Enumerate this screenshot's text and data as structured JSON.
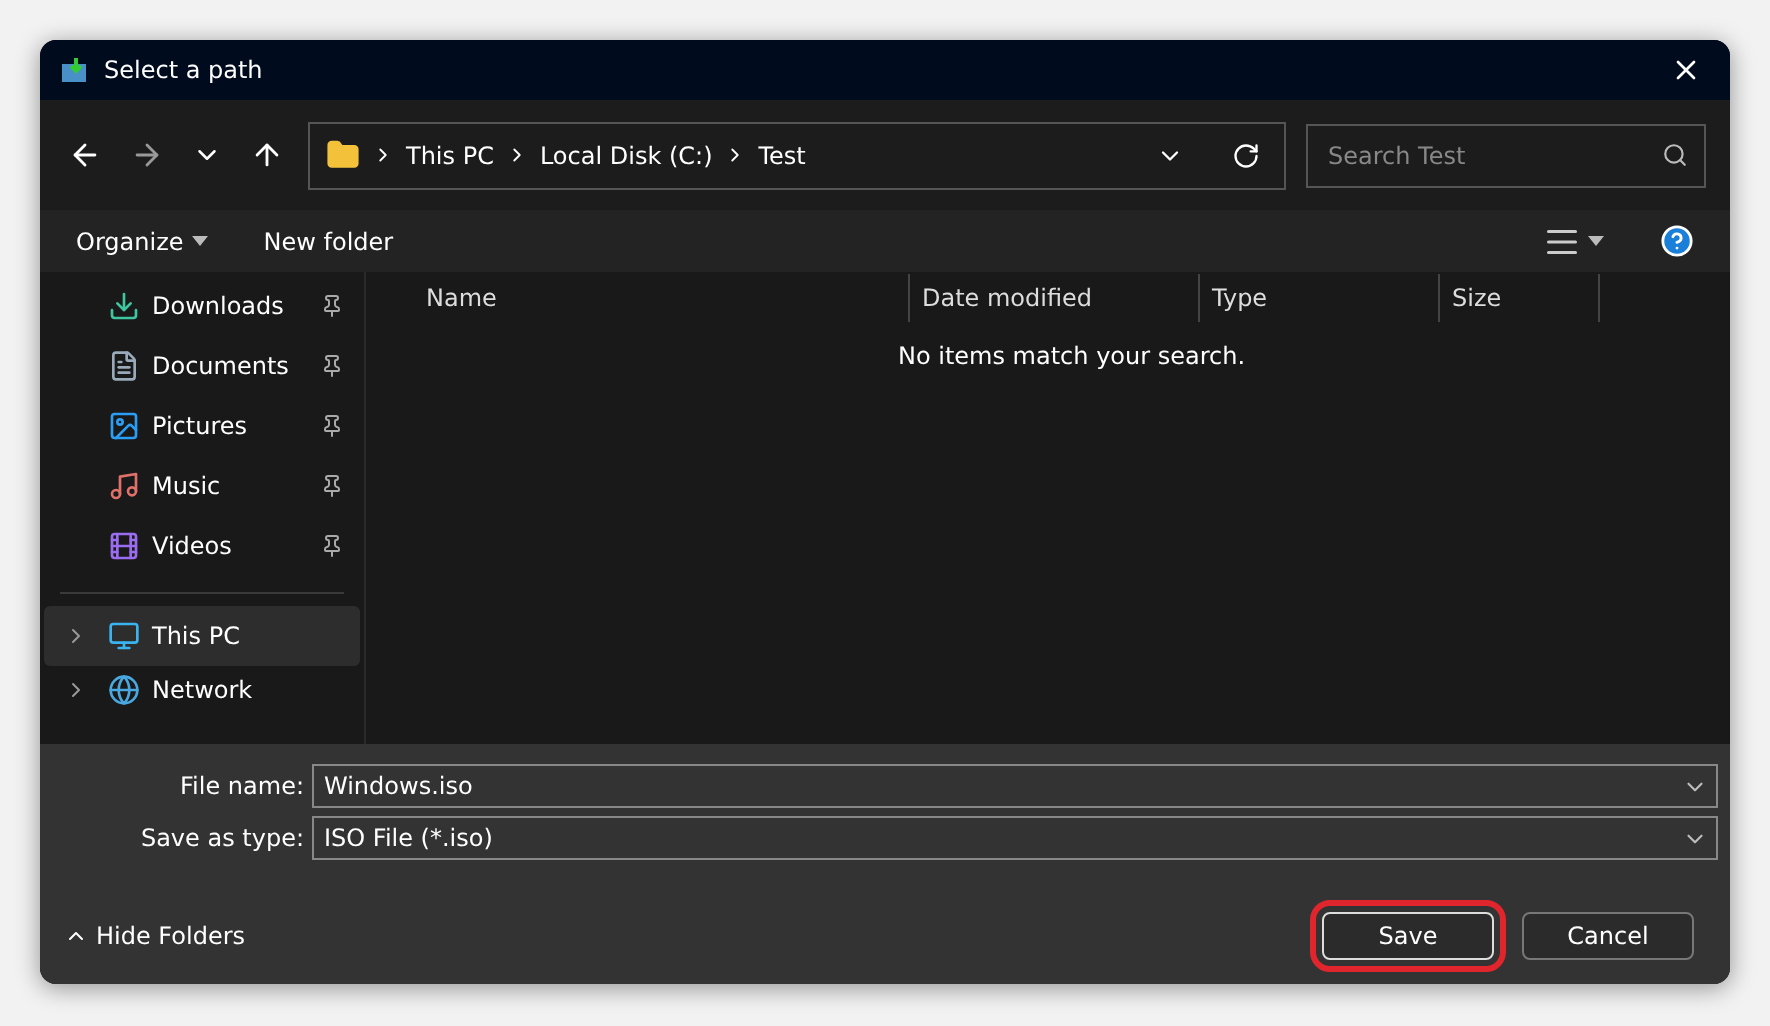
{
  "window": {
    "title": "Select a path"
  },
  "nav": {
    "path": [
      "This PC",
      "Local Disk (C:)",
      "Test"
    ],
    "search": {
      "placeholder": "Search Test"
    }
  },
  "toolbar": {
    "organize": "Organize",
    "new_folder": "New folder"
  },
  "sidebar": {
    "items": [
      {
        "label": "Downloads",
        "pinned": true,
        "selected": false,
        "kind": "quick"
      },
      {
        "label": "Documents",
        "pinned": true,
        "selected": false,
        "kind": "quick"
      },
      {
        "label": "Pictures",
        "pinned": true,
        "selected": false,
        "kind": "quick"
      },
      {
        "label": "Music",
        "pinned": true,
        "selected": false,
        "kind": "quick"
      },
      {
        "label": "Videos",
        "pinned": true,
        "selected": false,
        "kind": "quick"
      },
      {
        "label": "This PC",
        "pinned": false,
        "selected": true,
        "kind": "root"
      },
      {
        "label": "Network",
        "pinned": false,
        "selected": false,
        "kind": "root"
      }
    ]
  },
  "table": {
    "columns": [
      "Name",
      "Date modified",
      "Type",
      "Size"
    ],
    "empty_message": "No items match your search."
  },
  "form": {
    "fields": [
      {
        "label": "File name:",
        "value": "Windows.iso"
      },
      {
        "label": "Save as type:",
        "value": "ISO File (*.iso)"
      }
    ]
  },
  "footer": {
    "hide_folders": "Hide Folders",
    "buttons": [
      {
        "label": "Save",
        "highlighted": true
      },
      {
        "label": "Cancel",
        "highlighted": false
      }
    ]
  }
}
